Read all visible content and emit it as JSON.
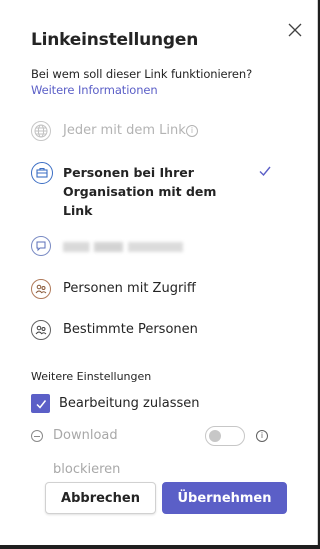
{
  "dialog": {
    "title": "Linkeinstellungen",
    "question": "Bei wem soll dieser Link funktionieren?",
    "more_info": "Weitere Informationen",
    "close_icon": "close-icon"
  },
  "options": [
    {
      "label": "Jeder mit dem Link",
      "icon": "globe-icon",
      "state": "disabled"
    },
    {
      "label": "Personen bei Ihrer Organisation mit dem Link",
      "icon": "building-icon",
      "state": "selected"
    },
    {
      "label": "",
      "icon": "chat-icon",
      "state": "redacted"
    },
    {
      "label": "Personen mit Zugriff",
      "icon": "people-icon",
      "state": "normal"
    },
    {
      "label": "Bestimmte Personen",
      "icon": "people-icon",
      "state": "normal"
    }
  ],
  "settings": {
    "section_title": "Weitere Einstellungen",
    "allow_edit": {
      "label": "Bearbeitung zulassen",
      "checked": true
    },
    "block_download": {
      "label_line1": "Download",
      "label_line2": "blockieren",
      "enabled": false,
      "toggle_on": false
    }
  },
  "buttons": {
    "cancel": "Abbrechen",
    "apply": "Übernehmen"
  },
  "colors": {
    "accent": "#5b5fc7",
    "selected_icon": "#3b6ec4",
    "disabled_text": "#b3b3b3"
  }
}
